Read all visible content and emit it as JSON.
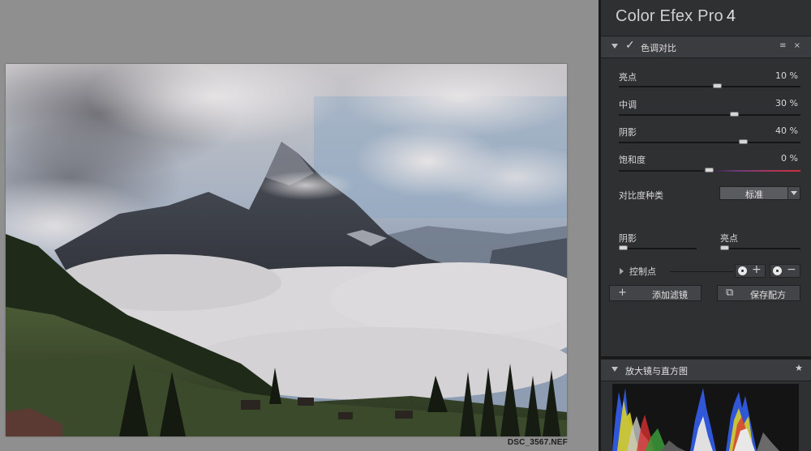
{
  "app": {
    "brand": "Color Efex Pro",
    "version": "4"
  },
  "canvas": {
    "filename": "DSC_3567.NEF"
  },
  "filter": {
    "title": "色调对比",
    "enabled": true,
    "header_tools": "≡  ×",
    "sliders": [
      {
        "label": "亮点",
        "value_text": "10 %",
        "value": 10
      },
      {
        "label": "中调",
        "value_text": "30 %",
        "value": 30
      },
      {
        "label": "阴影",
        "value_text": "40 %",
        "value": 40
      },
      {
        "label": "饱和度",
        "value_text": "0 %",
        "value": 0
      }
    ],
    "contrast_type": {
      "label": "对比度种类",
      "selected": "标准"
    },
    "protect": {
      "shadows_label": "阴影",
      "highlights_label": "亮点"
    },
    "control_points": {
      "label": "控制点",
      "add_symbol": "+",
      "remove_symbol": "−"
    }
  },
  "actions": {
    "add_filter": {
      "icon": "+",
      "label": "添加滤镜"
    },
    "save_recipe": {
      "icon": "⧉",
      "label": "保存配方"
    }
  },
  "loupe": {
    "title": "放大镜与直方图",
    "pin_icon": "★"
  },
  "colors": {
    "panel_bg": "#2f3032",
    "section_header": "#3b3c3f",
    "canvas_bg": "#8f8f8f"
  }
}
